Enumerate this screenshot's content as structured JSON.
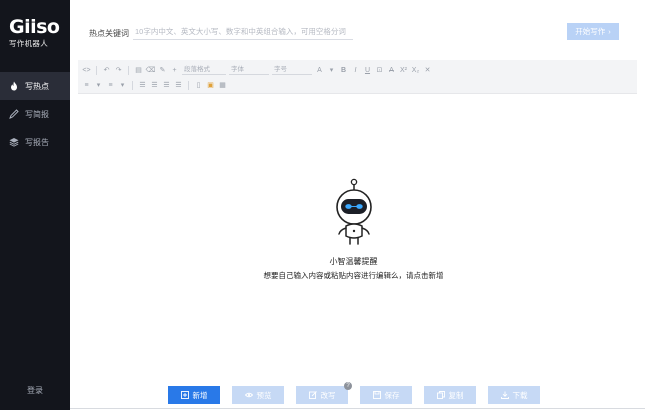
{
  "brand": {
    "logo": "Giiso",
    "subtitle": "写作机器人"
  },
  "sidebar": {
    "items": [
      {
        "label": "写热点",
        "icon": "flame-icon",
        "active": true
      },
      {
        "label": "写简报",
        "icon": "pen-icon",
        "active": false
      },
      {
        "label": "写报告",
        "icon": "layers-icon",
        "active": false
      }
    ],
    "login": "登录"
  },
  "topbar": {
    "keyword_label": "热点关键词",
    "keyword_placeholder": "10字内中文、英文大小写、数字和中英组合输入，可用空格分词",
    "start_button": "开始写作"
  },
  "toolbar": {
    "style_select": "段落格式",
    "font_select": "字体",
    "size_select": "字号"
  },
  "empty_state": {
    "title": "小智温馨提醒",
    "description": "想要自己输入内容或粘贴内容进行编辑么，请点击新增"
  },
  "actions": {
    "new": "新增",
    "preview": "预览",
    "rewrite": "改写",
    "rewrite_badge": "?",
    "save": "保存",
    "copy": "复制",
    "download": "下载"
  },
  "colors": {
    "sidebar_bg": "#13151c",
    "accent": "#2979e8",
    "disabled_button": "#c6d9f5"
  }
}
